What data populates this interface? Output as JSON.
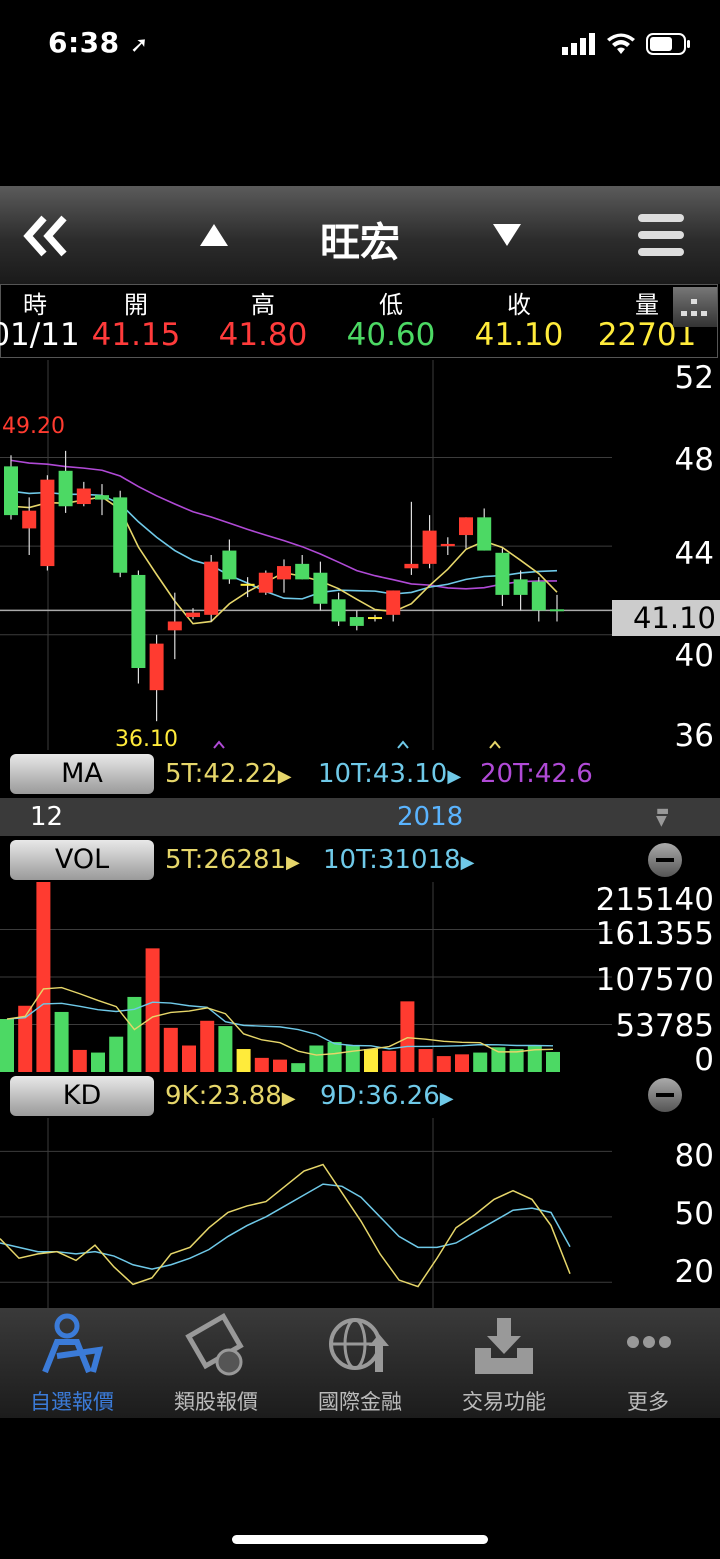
{
  "status": {
    "time": "6:38"
  },
  "nav": {
    "title": "旺宏"
  },
  "quote": {
    "headers": [
      "時",
      "開",
      "高",
      "低",
      "收",
      "量"
    ],
    "values": [
      "01/11",
      "41.15",
      "41.80",
      "40.60",
      "41.10",
      "22701"
    ],
    "colors": [
      "#ffffff",
      "#ff3b3b",
      "#ff3b3b",
      "#4cd964",
      "#ffeb3b",
      "#ffeb3b"
    ]
  },
  "price_panel": {
    "y_ticks": [
      "52",
      "48",
      "44",
      "40",
      "36"
    ],
    "current_price": "41.10",
    "high_label": "49.20",
    "low_label": "36.10"
  },
  "ma": {
    "button": "MA",
    "ma5": "5T:42.22",
    "ma10": "10T:43.10",
    "ma20": "20T:42.6"
  },
  "date_bar": {
    "month": "12",
    "year": "2018"
  },
  "vol": {
    "button": "VOL",
    "v5": "5T:26281",
    "v10": "10T:31018",
    "y_ticks": [
      "215140",
      "161355",
      "107570",
      "53785",
      "0"
    ]
  },
  "kd": {
    "button": "KD",
    "k": "9K:23.88",
    "d": "9D:36.26",
    "y_ticks": [
      "80",
      "50",
      "20"
    ]
  },
  "tabs": [
    {
      "label": "自選報價",
      "icon": "watchlist-icon",
      "active": true
    },
    {
      "label": "類股報價",
      "icon": "film-coin-icon",
      "active": false
    },
    {
      "label": "國際金融",
      "icon": "globe-icon",
      "active": false
    },
    {
      "label": "交易功能",
      "icon": "tray-download-icon",
      "active": false
    },
    {
      "label": "更多",
      "icon": "more-dots-icon",
      "active": false
    }
  ],
  "colors": {
    "up": "#ff3b30",
    "down": "#4cd964",
    "flat": "#ffeb3b",
    "ma5": "#e6d66a",
    "ma10": "#6fc9e8",
    "ma20": "#b04ad6",
    "accent": "#3b7bd8"
  },
  "chart_data": {
    "type": "candlestick",
    "candles": [
      {
        "o": 47.6,
        "h": 48.1,
        "l": 45.2,
        "c": 45.4
      },
      {
        "o": 44.8,
        "h": 46.2,
        "l": 43.6,
        "c": 45.6
      },
      {
        "o": 43.1,
        "h": 47.2,
        "l": 42.9,
        "c": 47.0
      },
      {
        "o": 47.4,
        "h": 48.3,
        "l": 45.5,
        "c": 45.8
      },
      {
        "o": 45.9,
        "h": 46.9,
        "l": 45.8,
        "c": 46.6
      },
      {
        "o": 46.3,
        "h": 46.8,
        "l": 45.4,
        "c": 46.1
      },
      {
        "o": 46.2,
        "h": 46.5,
        "l": 42.6,
        "c": 42.8
      },
      {
        "o": 42.7,
        "h": 42.9,
        "l": 37.8,
        "c": 38.5
      },
      {
        "o": 37.5,
        "h": 40.0,
        "l": 36.1,
        "c": 39.6
      },
      {
        "o": 40.2,
        "h": 41.9,
        "l": 38.9,
        "c": 40.6
      },
      {
        "o": 40.8,
        "h": 41.2,
        "l": 40.7,
        "c": 41.0
      },
      {
        "o": 40.9,
        "h": 43.6,
        "l": 40.6,
        "c": 43.3
      },
      {
        "o": 43.8,
        "h": 44.3,
        "l": 42.3,
        "c": 42.5
      },
      {
        "o": 42.3,
        "h": 42.6,
        "l": 41.7,
        "c": 42.3
      },
      {
        "o": 41.9,
        "h": 42.9,
        "l": 41.8,
        "c": 42.8
      },
      {
        "o": 42.5,
        "h": 43.4,
        "l": 41.9,
        "c": 43.1
      },
      {
        "o": 43.2,
        "h": 43.6,
        "l": 42.5,
        "c": 42.5
      },
      {
        "o": 42.8,
        "h": 43.3,
        "l": 41.1,
        "c": 41.4
      },
      {
        "o": 41.6,
        "h": 41.9,
        "l": 40.4,
        "c": 40.6
      },
      {
        "o": 40.8,
        "h": 41.1,
        "l": 40.2,
        "c": 40.4
      },
      {
        "o": 40.8,
        "h": 40.9,
        "l": 40.6,
        "c": 40.8
      },
      {
        "o": 40.9,
        "h": 42.0,
        "l": 40.6,
        "c": 42.0
      },
      {
        "o": 43.0,
        "h": 46.0,
        "l": 42.7,
        "c": 43.2
      },
      {
        "o": 43.2,
        "h": 45.4,
        "l": 43.0,
        "c": 44.7
      },
      {
        "o": 44.0,
        "h": 44.4,
        "l": 43.6,
        "c": 44.1
      },
      {
        "o": 44.5,
        "h": 45.3,
        "l": 43.9,
        "c": 45.3
      },
      {
        "o": 45.3,
        "h": 45.7,
        "l": 43.8,
        "c": 43.8
      },
      {
        "o": 43.7,
        "h": 43.9,
        "l": 41.3,
        "c": 41.8
      },
      {
        "o": 42.5,
        "h": 42.9,
        "l": 41.1,
        "c": 41.8
      },
      {
        "o": 42.4,
        "h": 42.6,
        "l": 40.6,
        "c": 41.1
      },
      {
        "o": 41.15,
        "h": 41.8,
        "l": 40.6,
        "c": 41.1
      }
    ],
    "volumes": [
      60000,
      75000,
      215140,
      68000,
      25000,
      22000,
      40000,
      85000,
      140000,
      50000,
      30000,
      58000,
      52000,
      26000,
      16000,
      14000,
      10000,
      30000,
      34000,
      30000,
      26000,
      24000,
      80000,
      26000,
      18000,
      20000,
      22000,
      28000,
      26000,
      30000,
      22701
    ]
  }
}
